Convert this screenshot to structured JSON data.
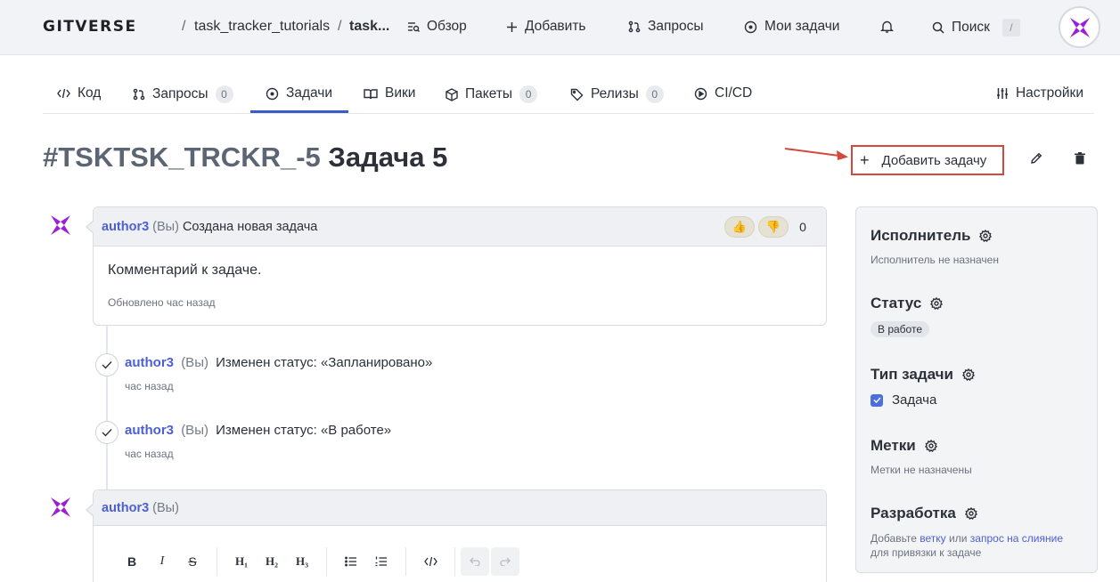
{
  "header": {
    "logo": "GITVERSE",
    "sep": "/",
    "repo": "task_tracker_tutorials",
    "repo_short": "task...",
    "nav": {
      "overview": "Обзор",
      "add": "Добавить",
      "requests": "Запросы",
      "my_tasks": "Мои задачи",
      "search": "Поиск",
      "search_kbd": "/"
    }
  },
  "tabs": {
    "code": "Код",
    "requests": "Запросы",
    "requests_count": "0",
    "tasks": "Задачи",
    "wiki": "Вики",
    "packages": "Пакеты",
    "packages_count": "0",
    "releases": "Релизы",
    "releases_count": "0",
    "cicd": "CI/CD",
    "settings": "Настройки"
  },
  "issue": {
    "number": "#TSKTSK_TRCKR_-5",
    "title": "Задача 5",
    "add_task_label": "Добавить задачу",
    "add_plus": "+"
  },
  "comment": {
    "author": "author3",
    "you": "(Вы)",
    "action": "Создана новая задача",
    "reaction_count": "0",
    "body": "Комментарий к задаче.",
    "updated": "Обновлено час назад"
  },
  "events": [
    {
      "author": "author3",
      "you": "(Вы)",
      "text": "Изменен статус: «Запланировано»",
      "time": "час назад"
    },
    {
      "author": "author3",
      "you": "(Вы)",
      "text": "Изменен статус: «В работе»",
      "time": "час назад"
    }
  ],
  "editor": {
    "author": "author3",
    "you": "(Вы)",
    "tools": {
      "bold": "B",
      "italic": "I",
      "strike": "S",
      "h1": "H₁",
      "h2": "H₂",
      "h3": "H₃"
    }
  },
  "sidebar": {
    "assignee": {
      "title": "Исполнитель",
      "note": "Исполнитель не назначен"
    },
    "status": {
      "title": "Статус",
      "value": "В работе"
    },
    "type": {
      "title": "Тип задачи",
      "value": "Задача"
    },
    "labels": {
      "title": "Метки",
      "note": "Метки не назначены"
    },
    "dev": {
      "title": "Разработка",
      "prefix": "Добавьте",
      "branch": "ветку",
      "or": "или",
      "mr": "запрос на слияние",
      "suffix": "для привязки к задаче"
    }
  },
  "colors": {
    "accent": "#3d5cc4",
    "link": "#4c5fd5",
    "annotation": "#d24a3c",
    "avatar_purple": "#9b1fd6"
  }
}
